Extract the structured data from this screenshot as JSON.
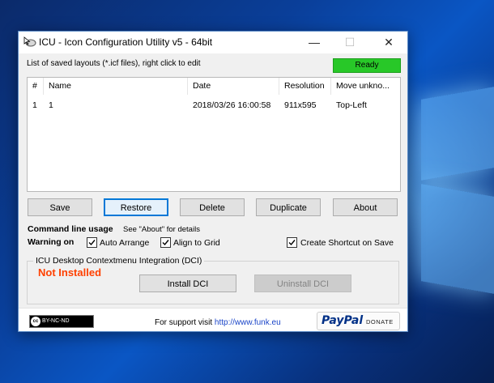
{
  "window": {
    "title": "ICU - Icon Configuration Utility v5 - 64bit",
    "minimize_glyph": "—",
    "maximize_glyph": "☐",
    "close_glyph": "✕",
    "icons": {
      "app": "mouse-cursor-icon"
    }
  },
  "status": {
    "hint": "List of saved layouts (*.icf files), right click to edit",
    "ready": "Ready",
    "ready_color": "#28c828"
  },
  "layouts": {
    "columns": [
      "#",
      "Name",
      "Date",
      "Resolution",
      "Move unkno..."
    ],
    "rows": [
      [
        "1",
        "1",
        "2018/03/26 16:00:58",
        "911x595",
        "Top-Left"
      ]
    ]
  },
  "buttons": {
    "save": "Save",
    "restore": "Restore",
    "delete": "Delete",
    "duplicate": "Duplicate",
    "about": "About"
  },
  "options": {
    "cmdline_label": "Command line usage",
    "cmdline_hint": "See \"About\" for details",
    "warning_label": "Warning on",
    "auto_arrange": "Auto Arrange",
    "auto_arrange_checked": true,
    "align_to_grid": "Align to Grid",
    "align_to_grid_checked": true,
    "create_shortcut": "Create Shortcut on Save",
    "create_shortcut_checked": true
  },
  "dci": {
    "group_title": "ICU Desktop Contextmenu Integration (DCI)",
    "status": "Not Installed",
    "status_color": "#ff4000",
    "install": "Install DCI",
    "uninstall": "Uninstall DCI"
  },
  "footer": {
    "license": "BY-NC-ND",
    "license_mark": "cc",
    "support_prefix": "For support visit",
    "support_link": "http://www.funk.eu",
    "paypal": "PayPal",
    "donate": "DONATE"
  }
}
